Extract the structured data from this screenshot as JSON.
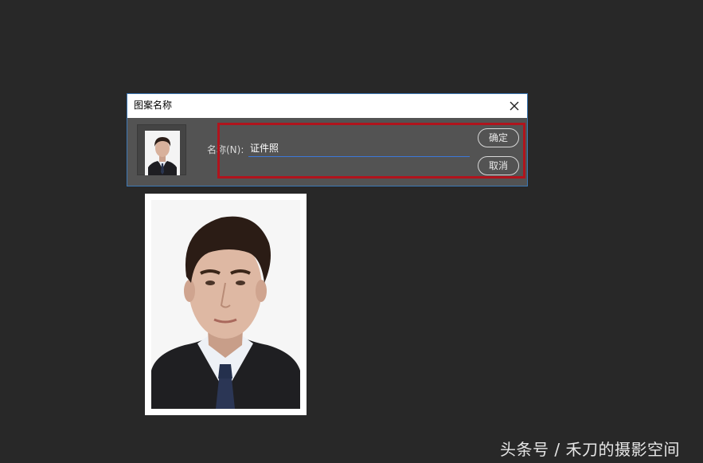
{
  "dialog": {
    "title": "图案名称",
    "name_label": "名称(N):",
    "name_value": "证件照",
    "ok_label": "确定",
    "cancel_label": "取消",
    "close_icon": "close-icon"
  },
  "watermark": "头条号 / 禾刀的摄影空间",
  "colors": {
    "canvas_bg": "#282828",
    "dialog_body": "#535353",
    "highlight_box": "#b0141d",
    "input_underline": "#3c78d8"
  }
}
